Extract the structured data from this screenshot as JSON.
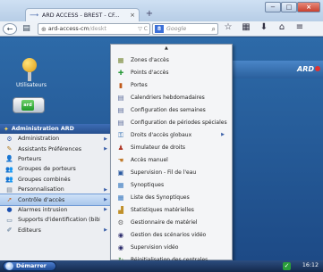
{
  "browser": {
    "tab_title": "ARD ACCESS - BREST - CF...",
    "tab_close": "×",
    "new_tab": "+",
    "url": "ard-access-cm",
    "url_dim": "/deskt",
    "search_placeholder": "Google",
    "window_controls": {
      "minimize": "−",
      "maximize": "□",
      "close": "×"
    }
  },
  "desktop": {
    "users_label": "Utilisateurs",
    "app_icon_label": "ard",
    "brand": "ARD"
  },
  "start_menu": {
    "header": "Administration ARD",
    "items": [
      {
        "label": "Administration",
        "icon": "settings-icon",
        "glyph": "⚙",
        "has_submenu": true
      },
      {
        "label": "Assistants Préférences",
        "icon": "wand-icon",
        "glyph": "✎",
        "has_submenu": true
      },
      {
        "label": "Porteurs",
        "icon": "person-icon",
        "glyph": "👤",
        "has_submenu": false
      },
      {
        "label": "Groupes de porteurs",
        "icon": "people-icon",
        "glyph": "👥",
        "has_submenu": false
      },
      {
        "label": "Groupes combinés",
        "icon": "people-icon",
        "glyph": "👥",
        "has_submenu": false
      },
      {
        "label": "Personnalisation",
        "icon": "brush-icon",
        "glyph": "▤",
        "has_submenu": true
      },
      {
        "label": "Contrôle d'accès",
        "icon": "door-icon",
        "glyph": "➚",
        "has_submenu": true,
        "active": true
      },
      {
        "label": "Alarmes intrusion",
        "icon": "alarm-icon",
        "glyph": "●",
        "has_submenu": true
      },
      {
        "label": "Supports d'identification (bibl",
        "icon": "card-icon",
        "glyph": "▭",
        "has_submenu": false
      },
      {
        "label": "Éditeurs",
        "icon": "editor-icon",
        "glyph": "✐",
        "has_submenu": true
      }
    ]
  },
  "submenu": {
    "scroll_up": "▲",
    "items": [
      {
        "label": "Zones d'accès",
        "icon": "zone-icon",
        "glyph": "▦"
      },
      {
        "label": "Points d'accès",
        "icon": "point-icon",
        "glyph": "✚"
      },
      {
        "label": "Portes",
        "icon": "door-icon",
        "glyph": "▮"
      },
      {
        "label": "Calendriers hebdomadaires",
        "icon": "calendar-icon",
        "glyph": "▤"
      },
      {
        "label": "Configuration des semaines",
        "icon": "calendar-icon",
        "glyph": "▤"
      },
      {
        "label": "Configuration de périodes spéciales",
        "icon": "calendar-icon",
        "glyph": "▤"
      },
      {
        "label": "Droits d'accès globaux",
        "icon": "key-icon",
        "glyph": "⚿",
        "has_submenu": true
      },
      {
        "label": "Simulateur de droits",
        "icon": "simulator-icon",
        "glyph": "♟"
      },
      {
        "label": "Accès manuel",
        "icon": "hand-icon",
        "glyph": "☚"
      },
      {
        "label": "Supervision - Fil de l'eau",
        "icon": "monitor-icon",
        "glyph": "▣"
      },
      {
        "label": "Synoptiques",
        "icon": "synoptic-icon",
        "glyph": "▦"
      },
      {
        "label": "Liste des Synoptiques",
        "icon": "list-icon",
        "glyph": "▦"
      },
      {
        "label": "Statistiques matérielles",
        "icon": "chart-icon",
        "glyph": "▟"
      },
      {
        "label": "Gestionnaire de matériel",
        "icon": "hardware-icon",
        "glyph": "⚙"
      },
      {
        "label": "Gestion des scénarios vidéo",
        "icon": "camera-icon",
        "glyph": "◉"
      },
      {
        "label": "Supervision vidéo",
        "icon": "camera-icon",
        "glyph": "◉"
      },
      {
        "label": "Réinitialisation des centrales",
        "icon": "reset-icon",
        "glyph": "↻"
      }
    ]
  },
  "taskbar": {
    "start_label": "Démarrer",
    "clock": "16:12"
  }
}
